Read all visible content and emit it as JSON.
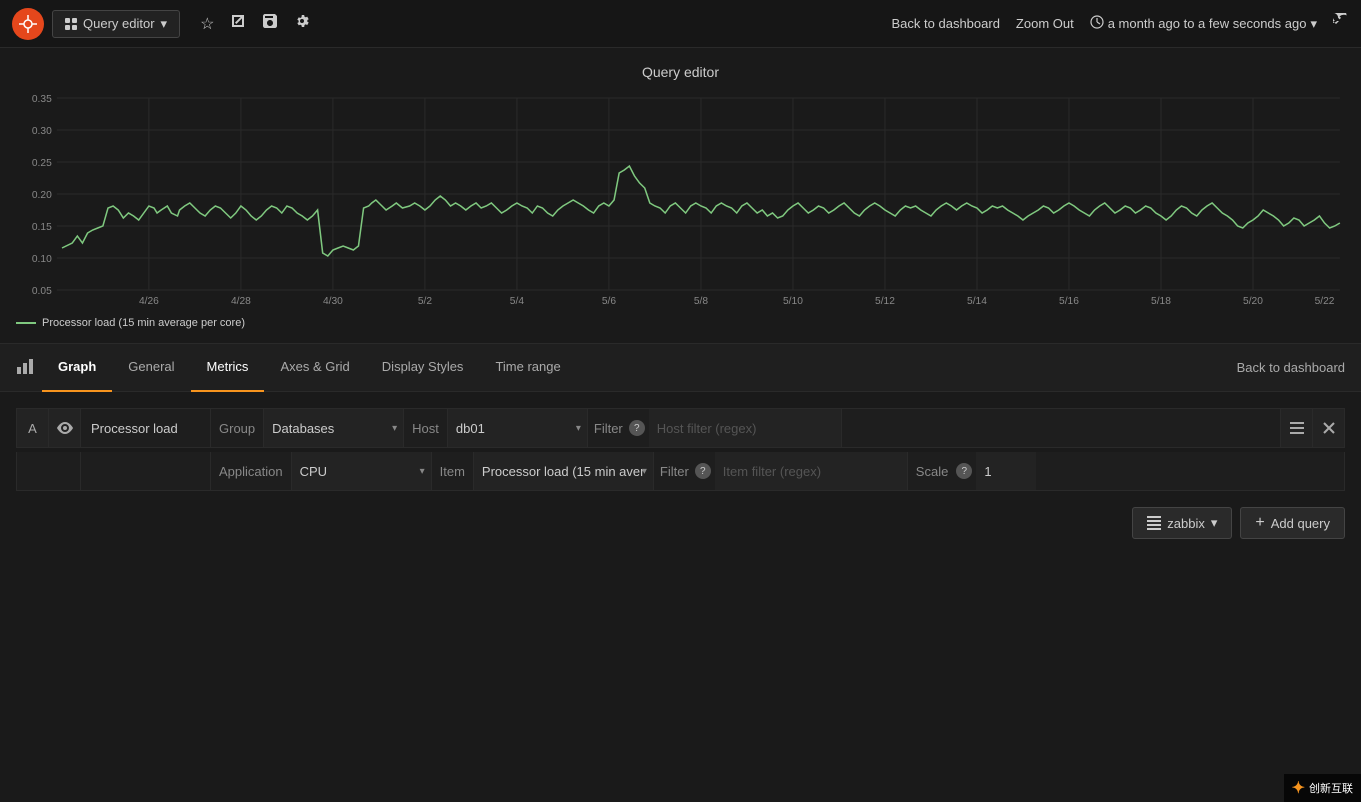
{
  "topnav": {
    "logo_label": "G",
    "query_editor_label": "Query editor",
    "dropdown_arrow": "▾",
    "star_icon": "☆",
    "share_icon": "↗",
    "save_icon": "💾",
    "settings_icon": "⚙",
    "back_dashboard": "Back to dashboard",
    "zoom_out": "Zoom Out",
    "time_range": "a month ago to a few seconds ago",
    "refresh_icon": "↺"
  },
  "chart": {
    "title": "Query editor",
    "y_axis": [
      "0.35",
      "0.30",
      "0.25",
      "0.20",
      "0.15",
      "0.10",
      "0.05"
    ],
    "x_axis": [
      "4/26",
      "4/28",
      "4/30",
      "5/2",
      "5/4",
      "5/6",
      "5/8",
      "5/10",
      "5/12",
      "5/14",
      "5/16",
      "5/18",
      "5/20",
      "5/22"
    ],
    "legend": "Processor load (15 min average per core)"
  },
  "tabs": {
    "graph_icon": "▐",
    "items": [
      {
        "label": "Graph",
        "active": true
      },
      {
        "label": "General",
        "active": false
      },
      {
        "label": "Metrics",
        "active": false
      },
      {
        "label": "Axes & Grid",
        "active": false
      },
      {
        "label": "Display Styles",
        "active": false
      },
      {
        "label": "Time range",
        "active": false
      }
    ],
    "back_link": "Back to dashboard"
  },
  "query": {
    "row1": {
      "letter": "A",
      "eye_icon": "👁",
      "label": "Processor load",
      "group_label": "Group",
      "group_value": "Databases",
      "host_label": "Host",
      "host_value": "db01",
      "filter_label": "Filter",
      "filter_placeholder": "Host filter (regex)"
    },
    "row2": {
      "app_label": "Application",
      "app_value": "CPU",
      "item_label": "Item",
      "item_value": "Processor load (15 min aver",
      "filter_label": "Filter",
      "filter_placeholder": "Item filter (regex)",
      "scale_label": "Scale",
      "scale_value": "1"
    },
    "zabbix_btn": "zabbix",
    "add_query_btn": "+ Add query"
  },
  "watermark": {
    "text": "创新互联"
  }
}
